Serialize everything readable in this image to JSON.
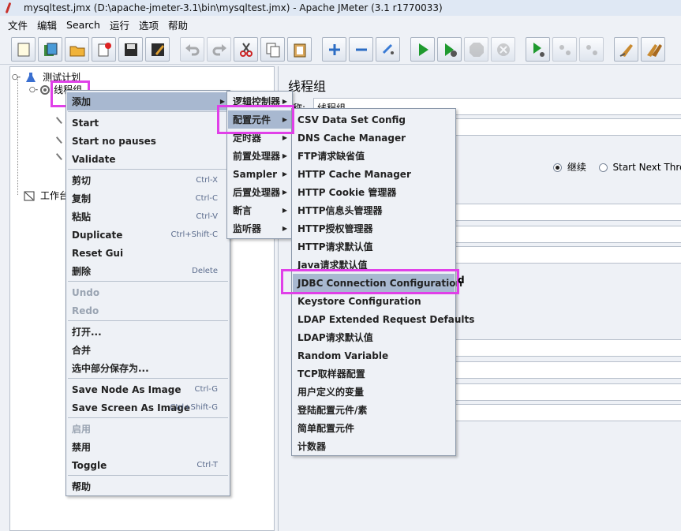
{
  "window": {
    "title": "mysqltest.jmx (D:\\apache-jmeter-3.1\\bin\\mysqltest.jmx) - Apache JMeter (3.1 r1770033)"
  },
  "menubar": {
    "items": [
      "文件",
      "编辑",
      "Search",
      "运行",
      "选项",
      "帮助"
    ]
  },
  "toolbar": {
    "buttons": [
      "new-icon",
      "templates-icon",
      "open-icon",
      "close-icon",
      "save-icon",
      "save-as-icon",
      "undo-icon",
      "redo-icon",
      "cut-icon",
      "copy-icon",
      "paste-icon",
      "expand-icon",
      "collapse-icon",
      "toggle-icon",
      "start-icon",
      "start-no-pauses-icon",
      "stop-icon",
      "shutdown-icon",
      "remote-start-icon",
      "remote-stop-icon",
      "remote-shutdown-icon",
      "clear-icon",
      "clear-all-icon"
    ]
  },
  "tree": {
    "root": "测试计划",
    "thread_group": "线程组",
    "workbench": "工作台"
  },
  "right_panel": {
    "heading": "线程组",
    "name_label": "称:",
    "name_value": "线程组",
    "radio_continue": "继续",
    "radio_next_thread": "Start Next Threa"
  },
  "context_menu": {
    "add": "添加",
    "items": [
      {
        "label": "Start",
        "shortcut": ""
      },
      {
        "label": "Start no pauses",
        "shortcut": ""
      },
      {
        "label": "Validate",
        "shortcut": ""
      },
      {
        "label": "剪切",
        "shortcut": "Ctrl-X"
      },
      {
        "label": "复制",
        "shortcut": "Ctrl-C"
      },
      {
        "label": "粘贴",
        "shortcut": "Ctrl-V"
      },
      {
        "label": "Duplicate",
        "shortcut": "Ctrl+Shift-C"
      },
      {
        "label": "Reset Gui",
        "shortcut": ""
      },
      {
        "label": "删除",
        "shortcut": "Delete"
      },
      {
        "label": "Undo",
        "shortcut": ""
      },
      {
        "label": "Redo",
        "shortcut": ""
      },
      {
        "label": "打开...",
        "shortcut": ""
      },
      {
        "label": "合并",
        "shortcut": ""
      },
      {
        "label": "选中部分保存为...",
        "shortcut": ""
      },
      {
        "label": "Save Node As Image",
        "shortcut": "Ctrl-G"
      },
      {
        "label": "Save Screen As Image",
        "shortcut": "Ctrl+Shift-G"
      },
      {
        "label": "启用",
        "shortcut": ""
      },
      {
        "label": "禁用",
        "shortcut": ""
      },
      {
        "label": "Toggle",
        "shortcut": "Ctrl-T"
      },
      {
        "label": "帮助",
        "shortcut": ""
      }
    ]
  },
  "add_submenu": {
    "items": [
      "逻辑控制器",
      "配置元件",
      "定时器",
      "前置处理器",
      "Sampler",
      "后置处理器",
      "断言",
      "监听器"
    ]
  },
  "config_submenu": {
    "items": [
      "CSV Data Set Config",
      "DNS Cache Manager",
      "FTP请求缺省值",
      "HTTP Cache Manager",
      "HTTP Cookie 管理器",
      "HTTP信息头管理器",
      "HTTP授权管理器",
      "HTTP请求默认值",
      "Java请求默认值",
      "JDBC Connection Configuration",
      "Keystore Configuration",
      "LDAP Extended Request Defaults",
      "LDAP请求默认值",
      "Random Variable",
      "TCP取样器配置",
      "用户定义的变量",
      "登陆配置元件/素",
      "简单配置元件",
      "计数器"
    ]
  },
  "colors": {
    "highlight": "#a8b8d0",
    "annotation": "#e040e8"
  }
}
